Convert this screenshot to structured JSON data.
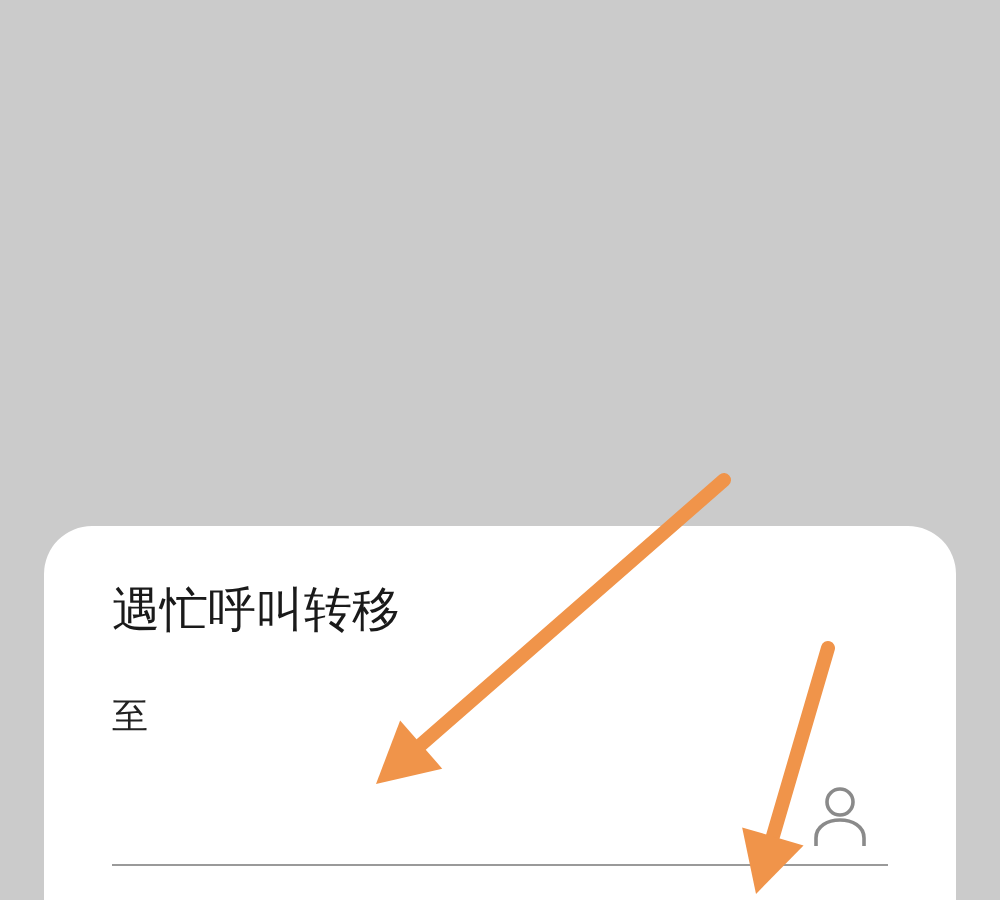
{
  "dialog": {
    "title": "遇忙呼叫转移",
    "field_label": "至"
  }
}
